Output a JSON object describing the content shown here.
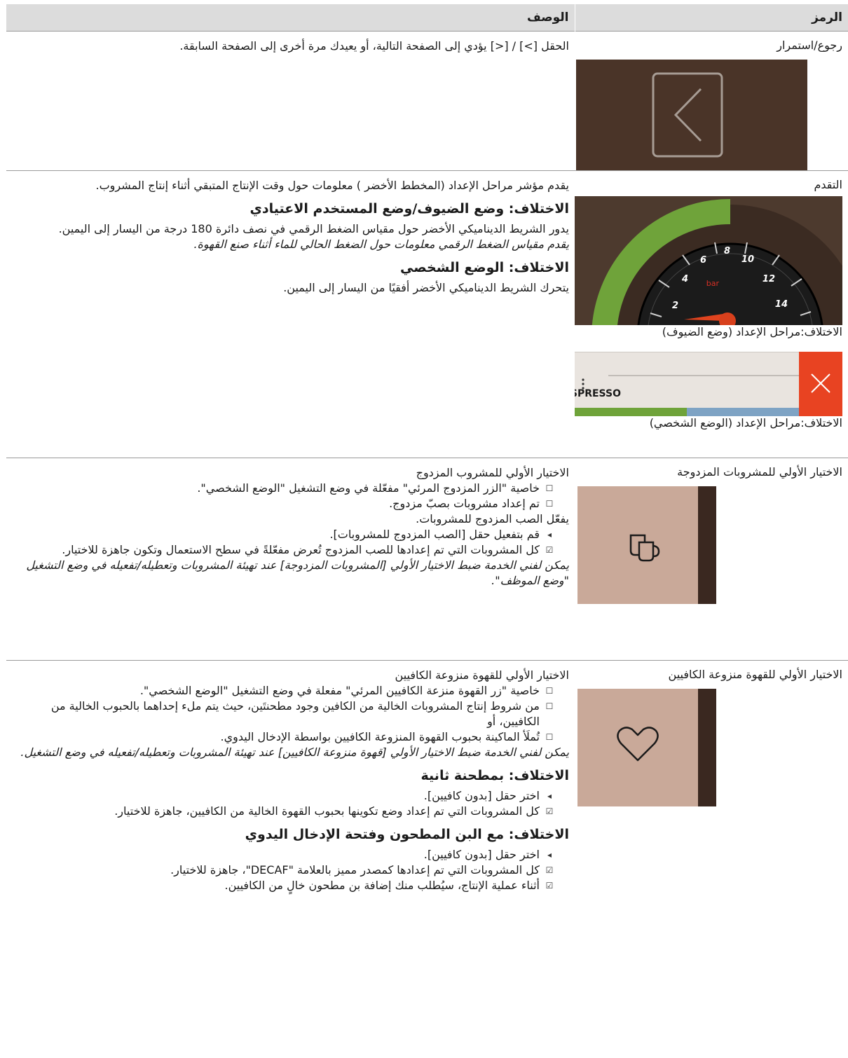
{
  "header": {
    "symbol": "الرمز",
    "description": "الوصف"
  },
  "rows": [
    {
      "title": "رجوع/استمرار",
      "lines": [
        "الحقل [>] / [<] يؤدي إلى الصفحة التالية، أو يعيدك مرة أخرى إلى الصفحة السابقة."
      ]
    },
    {
      "title": "التقدم",
      "intro": "يقدم مؤشر مراحل الإعداد (المخطط الأخضر ) معلومات حول وقت الإنتاج المتبقي أثناء إنتاج المشروب.",
      "h1": "الاختلاف: وضع الضيوف/وضع المستخدم الاعتيادي",
      "p1": "يدور الشريط الديناميكي الأخضر حول مقياس الضغط الرقمي في نصف دائرة 180 درجة من اليسار إلى اليمين.",
      "p1_italic": "يقدم مقياس الضغط الرقمي معلومات حول الضغط الحالي للماء أثناء صنع القهوة.",
      "h2": "الاختلاف: الوضع الشخصي",
      "p2": "يتحرك الشريط الديناميكي الأخضر أفقيًا من اليسار إلى اليمين.",
      "caption1": "الاختلاف:مراحل الإعداد (وضع الضيوف)",
      "caption2": "الاختلاف:مراحل الإعداد (الوضع الشخصي)",
      "gauge_ticks": [
        "2",
        "4",
        "6",
        "8",
        "10",
        "12",
        "14"
      ],
      "gauge_unit": "bar",
      "espresso_label": "ESPRESSO"
    },
    {
      "title": "الاختيار الأولي للمشروبات المزدوجة",
      "intro": "الاختيار الأولي للمشروب المزدوج",
      "pre": [
        "خاصية \"الزر المزدوج المرئي\" مفعّلة في وضع التشغيل \"الوضع الشخصي\".",
        "تم إعداد مشروبات بصبّ مزدوج."
      ],
      "mid": "يفعّل الصب المزدوج للمشروبات.",
      "step": "قم بتفعيل حقل [الصب المزدوج للمشروبات].",
      "result": "كل المشروبات التي تم إعدادها للصب المزدوج تُعرض مفعّلةً في سطح الاستعمال وتكون جاهزة للاختيار.",
      "note": "يمكن لفني الخدمة ضبط الاختيار الأولي [المشروبات المزدوجة] عند تهيئة المشروبات وتعطيله/تفعيله في وضع التشغيل \"وضع الموظف\"."
    },
    {
      "title": "الاختيار الأولي للقهوة منزوعة الكافيين",
      "intro": "الاختيار الأولي للقهوة منزوعة الكافيين",
      "pre": [
        "خاصية \"زر القهوة منزعة الكافيين المرئي\" مفعلة في وضع التشغيل \"الوضع الشخصي\".",
        "من شروط إنتاج المشروبات الخالية من الكافين وجود مطحنتَين، حيث يتم ملء إحداهما بالحبوب الخالية من الكافيين، أو",
        "تُملَأ الماكينة بحبوب القهوة المنزوعة الكافيين بواسطة الإدخال اليدوي."
      ],
      "note": "يمكن لفني الخدمة ضبط الاختيار الأولي [قهوة منزوعة الكافيين] عند تهيئة المشروبات وتعطيله/تفعيله في وضع التشغيل.",
      "h1": "الاختلاف: بمطحنة ثانية",
      "step1": "اختر حقل [بدون كافيين].",
      "result1": "كل المشروبات التي تم إعداد وضع تكوينها بحبوب القهوة الخالية من الكافيين، جاهزة للاختيار.",
      "h2": "الاختلاف: مع البن المطحون وفتحة الإدخال اليدوي",
      "step2": "اختر حقل [بدون كافيين].",
      "result2a": "كل المشروبات التي تم إعدادها كمصدر مميز بالعلامة \"DECAF\"، جاهزة للاختيار.",
      "result2b": "أثناء عملية الإنتاج، سيُطلب منك إضافة بن مطحون خالٍ من الكافيين."
    }
  ]
}
